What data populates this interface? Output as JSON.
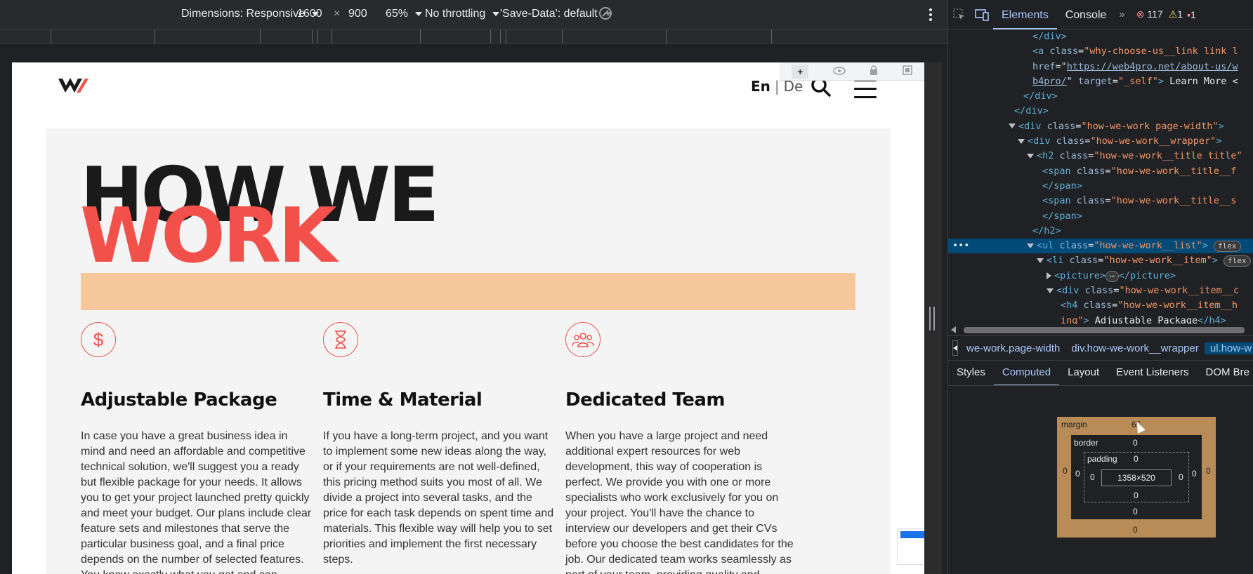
{
  "device_toolbar": {
    "dimensions_label": "Dimensions: Responsive",
    "width": "1600",
    "times": "×",
    "height": "900",
    "zoom": "65%",
    "throttling": "No throttling",
    "save_data": "'Save-Data': default"
  },
  "site": {
    "lang_active": "En",
    "lang_sep": "|",
    "lang_other": "De",
    "section_title_1": "HOW WE",
    "section_title_2": "WORK",
    "bubble_plus": "+",
    "columns": [
      {
        "icon": "dollar-icon",
        "icon_glyph": "$",
        "heading": "Adjustable Package",
        "text": "In case you have a great business idea in mind and need an affordable and competitive technical solution, we'll suggest you a ready but flexible package for your needs. It allows you to get your project launched pretty quickly and meet your budget. Our plans include clear feature sets and milestones that serve the particular business goal, and a final price depends on the number of selected features. You know exactly what you get and can decide what"
      },
      {
        "icon": "hourglass-icon",
        "icon_glyph": "⌛",
        "heading": "Time & Material",
        "text": "If you have a long-term project, and you want to implement some new ideas along the way, or if your requirements are not well-defined, this pricing method suits you most of all. We divide a project into several tasks, and the price for each task depends on spent time and materials. This flexible way will help you to set priorities and implement the first necessary steps."
      },
      {
        "icon": "team-icon",
        "icon_glyph": "👥",
        "heading": "Dedicated Team",
        "text": "When you have a large project and need additional expert resources for web development, this way of cooperation is perfect. We provide you with one or more specialists who work exclusively for you on your project. You'll have the chance to interview our developers and get their CVs before you choose the best candidates for the job. Our dedicated team works seamlessly as part of your team, providing quality and project-specific solutions."
      }
    ],
    "accent_color": "#f2514b",
    "bar_color": "#f5c79b"
  },
  "devtools": {
    "tabs": [
      "Elements",
      "Console"
    ],
    "more_tabs": "»",
    "errors": "117",
    "warnings": "1",
    "issues": "1",
    "dom_lines": {
      "l1": "</div>",
      "l2_tag": "<a",
      "l2_attr": "class",
      "l2_val": "\"why-choose-us__link link l",
      "l3_attr": "href",
      "l3_val": "https://web4pro.net/about-us/w",
      "l4_val": "b4pro/",
      "l4_rest_attr": "target",
      "l4_rest_val": "\"_self\"",
      "l4_text": "Learn More <",
      "l5": "</div>",
      "l6": "</div>",
      "l7_attr": "class",
      "l7_val": "\"how-we-work page-width\"",
      "l8_val": "\"how-we-work__wrapper\"",
      "l9_val": "\"how-we-work__title title\"",
      "l10_val": "\"how-we-work__title__f",
      "l11": "</span>",
      "l12_val": "\"how-we-work__title__s",
      "l13": "</span>",
      "l14": "</h2>",
      "l15_val": "\"how-we-work__list\"",
      "l15_badge": "flex",
      "l16_val": "\"how-we-work__item\"",
      "l16_badge": "flex",
      "l17_open": "<picture>",
      "l17_ellipsis": "⋯",
      "l17_close": "</picture>",
      "l18_val": "\"how-we-work__item__c",
      "l19_val": "\"how-we-work__item__h",
      "l20_val": "ing\"",
      "l20_text": "Adjustable Package",
      "l20_close": "</h4>"
    },
    "breadcrumbs": [
      "we-work.page-width",
      "div.how-we-work__wrapper",
      "ul.how-w"
    ],
    "subtabs": [
      "Styles",
      "Computed",
      "Layout",
      "Event Listeners",
      "DOM Bre"
    ],
    "box_model": {
      "margin_label": "margin",
      "margin_top": "65",
      "margin_right": "0",
      "margin_bottom": "0",
      "margin_left": "0",
      "border_label": "border",
      "border_top": "0",
      "border_right": "0",
      "border_bottom": "0",
      "border_left": "0",
      "padding_label": "padding",
      "padding_top": "0",
      "padding_right": "0",
      "padding_bottom": "0",
      "padding_left": "0",
      "content": "1358×520"
    }
  }
}
